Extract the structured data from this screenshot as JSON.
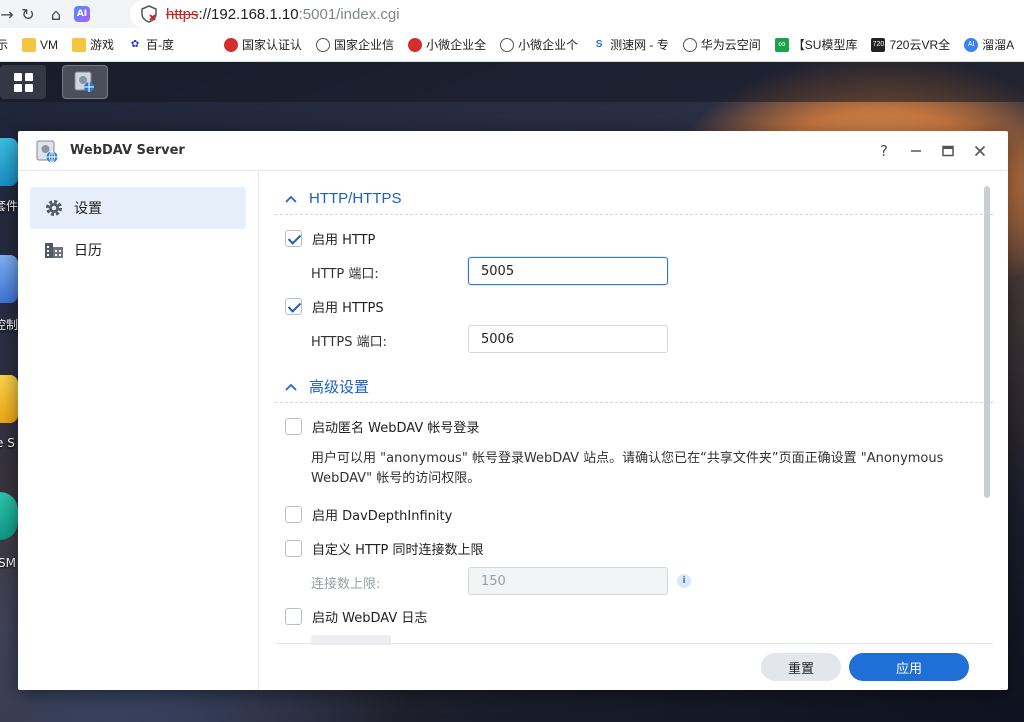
{
  "browser": {
    "url_scheme": "https",
    "url_host": "://192.168.1.10",
    "url_path": ":5001/index.cgi",
    "ai_badge": "AI",
    "bookmarks": [
      {
        "label": "示",
        "icon": "fragment"
      },
      {
        "label": "VM",
        "icon": "folder-icon"
      },
      {
        "label": "游戏",
        "icon": "folder-icon"
      },
      {
        "label": "百-度",
        "icon": "baidu-icon"
      },
      {
        "label": "国家认证认",
        "icon": "emblem-icon"
      },
      {
        "label": "国家企业信",
        "icon": "globe-icon"
      },
      {
        "label": "小微企业全",
        "icon": "emblem-icon"
      },
      {
        "label": "小微企业个",
        "icon": "globe-icon"
      },
      {
        "label": "测速网 - 专",
        "icon": "speedtest-icon"
      },
      {
        "label": "华为云空间",
        "icon": "globe-icon"
      },
      {
        "label": "【SU模型库",
        "icon": "su-icon"
      },
      {
        "label": "720云VR全",
        "icon": "720-icon"
      },
      {
        "label": "溜溜A",
        "icon": "ai-icon"
      }
    ]
  },
  "desktop": {
    "labels": [
      "套件",
      "控制",
      "e S",
      "SM"
    ]
  },
  "window": {
    "title": "WebDAV Server",
    "help": "?",
    "sidebar": [
      {
        "label": "设置",
        "active": true
      },
      {
        "label": "日历",
        "active": false
      }
    ],
    "sections": {
      "http": "HTTP/HTTPS",
      "advanced": "高级设置"
    },
    "enable_http": {
      "label": "启用 HTTP",
      "checked": true
    },
    "http_port": {
      "label": "HTTP 端口:",
      "value": "5005"
    },
    "enable_https": {
      "label": "启用 HTTPS",
      "checked": true
    },
    "https_port": {
      "label": "HTTPS 端口:",
      "value": "5006"
    },
    "anonymous": {
      "label": "启动匿名 WebDAV 帐号登录",
      "checked": false,
      "desc": "用户可以用 \"anonymous\" 帐号登录WebDAV 站点。请确认您已在“共享文件夹”页面正确设置 \"Anonymous WebDAV\" 帐号的访问权限。"
    },
    "depth_infinity": {
      "label": "启用 DavDepthInfinity",
      "checked": false
    },
    "custom_conn": {
      "label": "自定义 HTTP 同时连接数上限",
      "checked": false
    },
    "conn_limit": {
      "label": "连接数上限:",
      "value": "150"
    },
    "log": {
      "label": "启动 WebDAV 日志",
      "checked": false
    },
    "buttons": {
      "reset": "重置",
      "apply": "应用"
    }
  },
  "colors": {
    "accent": "#1f6fd6",
    "section_title": "#1d5fbf",
    "sidebar_active": "#e6eef9"
  }
}
